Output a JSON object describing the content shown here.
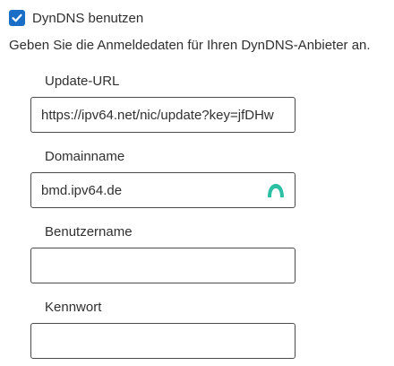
{
  "dyndns": {
    "checkbox_label": "DynDNS benutzen",
    "checked": true,
    "description": "Geben Sie die Anmeldedaten für Ihren DynDNS-Anbieter an."
  },
  "fields": {
    "update_url": {
      "label": "Update-URL",
      "value": "https://ipv64.net/nic/update?key=jfDHw"
    },
    "domain": {
      "label": "Domainname",
      "value": "bmd.ipv64.de",
      "icon": "password-manager-icon"
    },
    "username": {
      "label": "Benutzername",
      "value": ""
    },
    "password": {
      "label": "Kennwort",
      "value": ""
    }
  },
  "colors": {
    "checkbox": "#1a6ec6",
    "icon_accent": "#2bbfa4",
    "text": "#303030",
    "border": "#4a4a4a"
  }
}
